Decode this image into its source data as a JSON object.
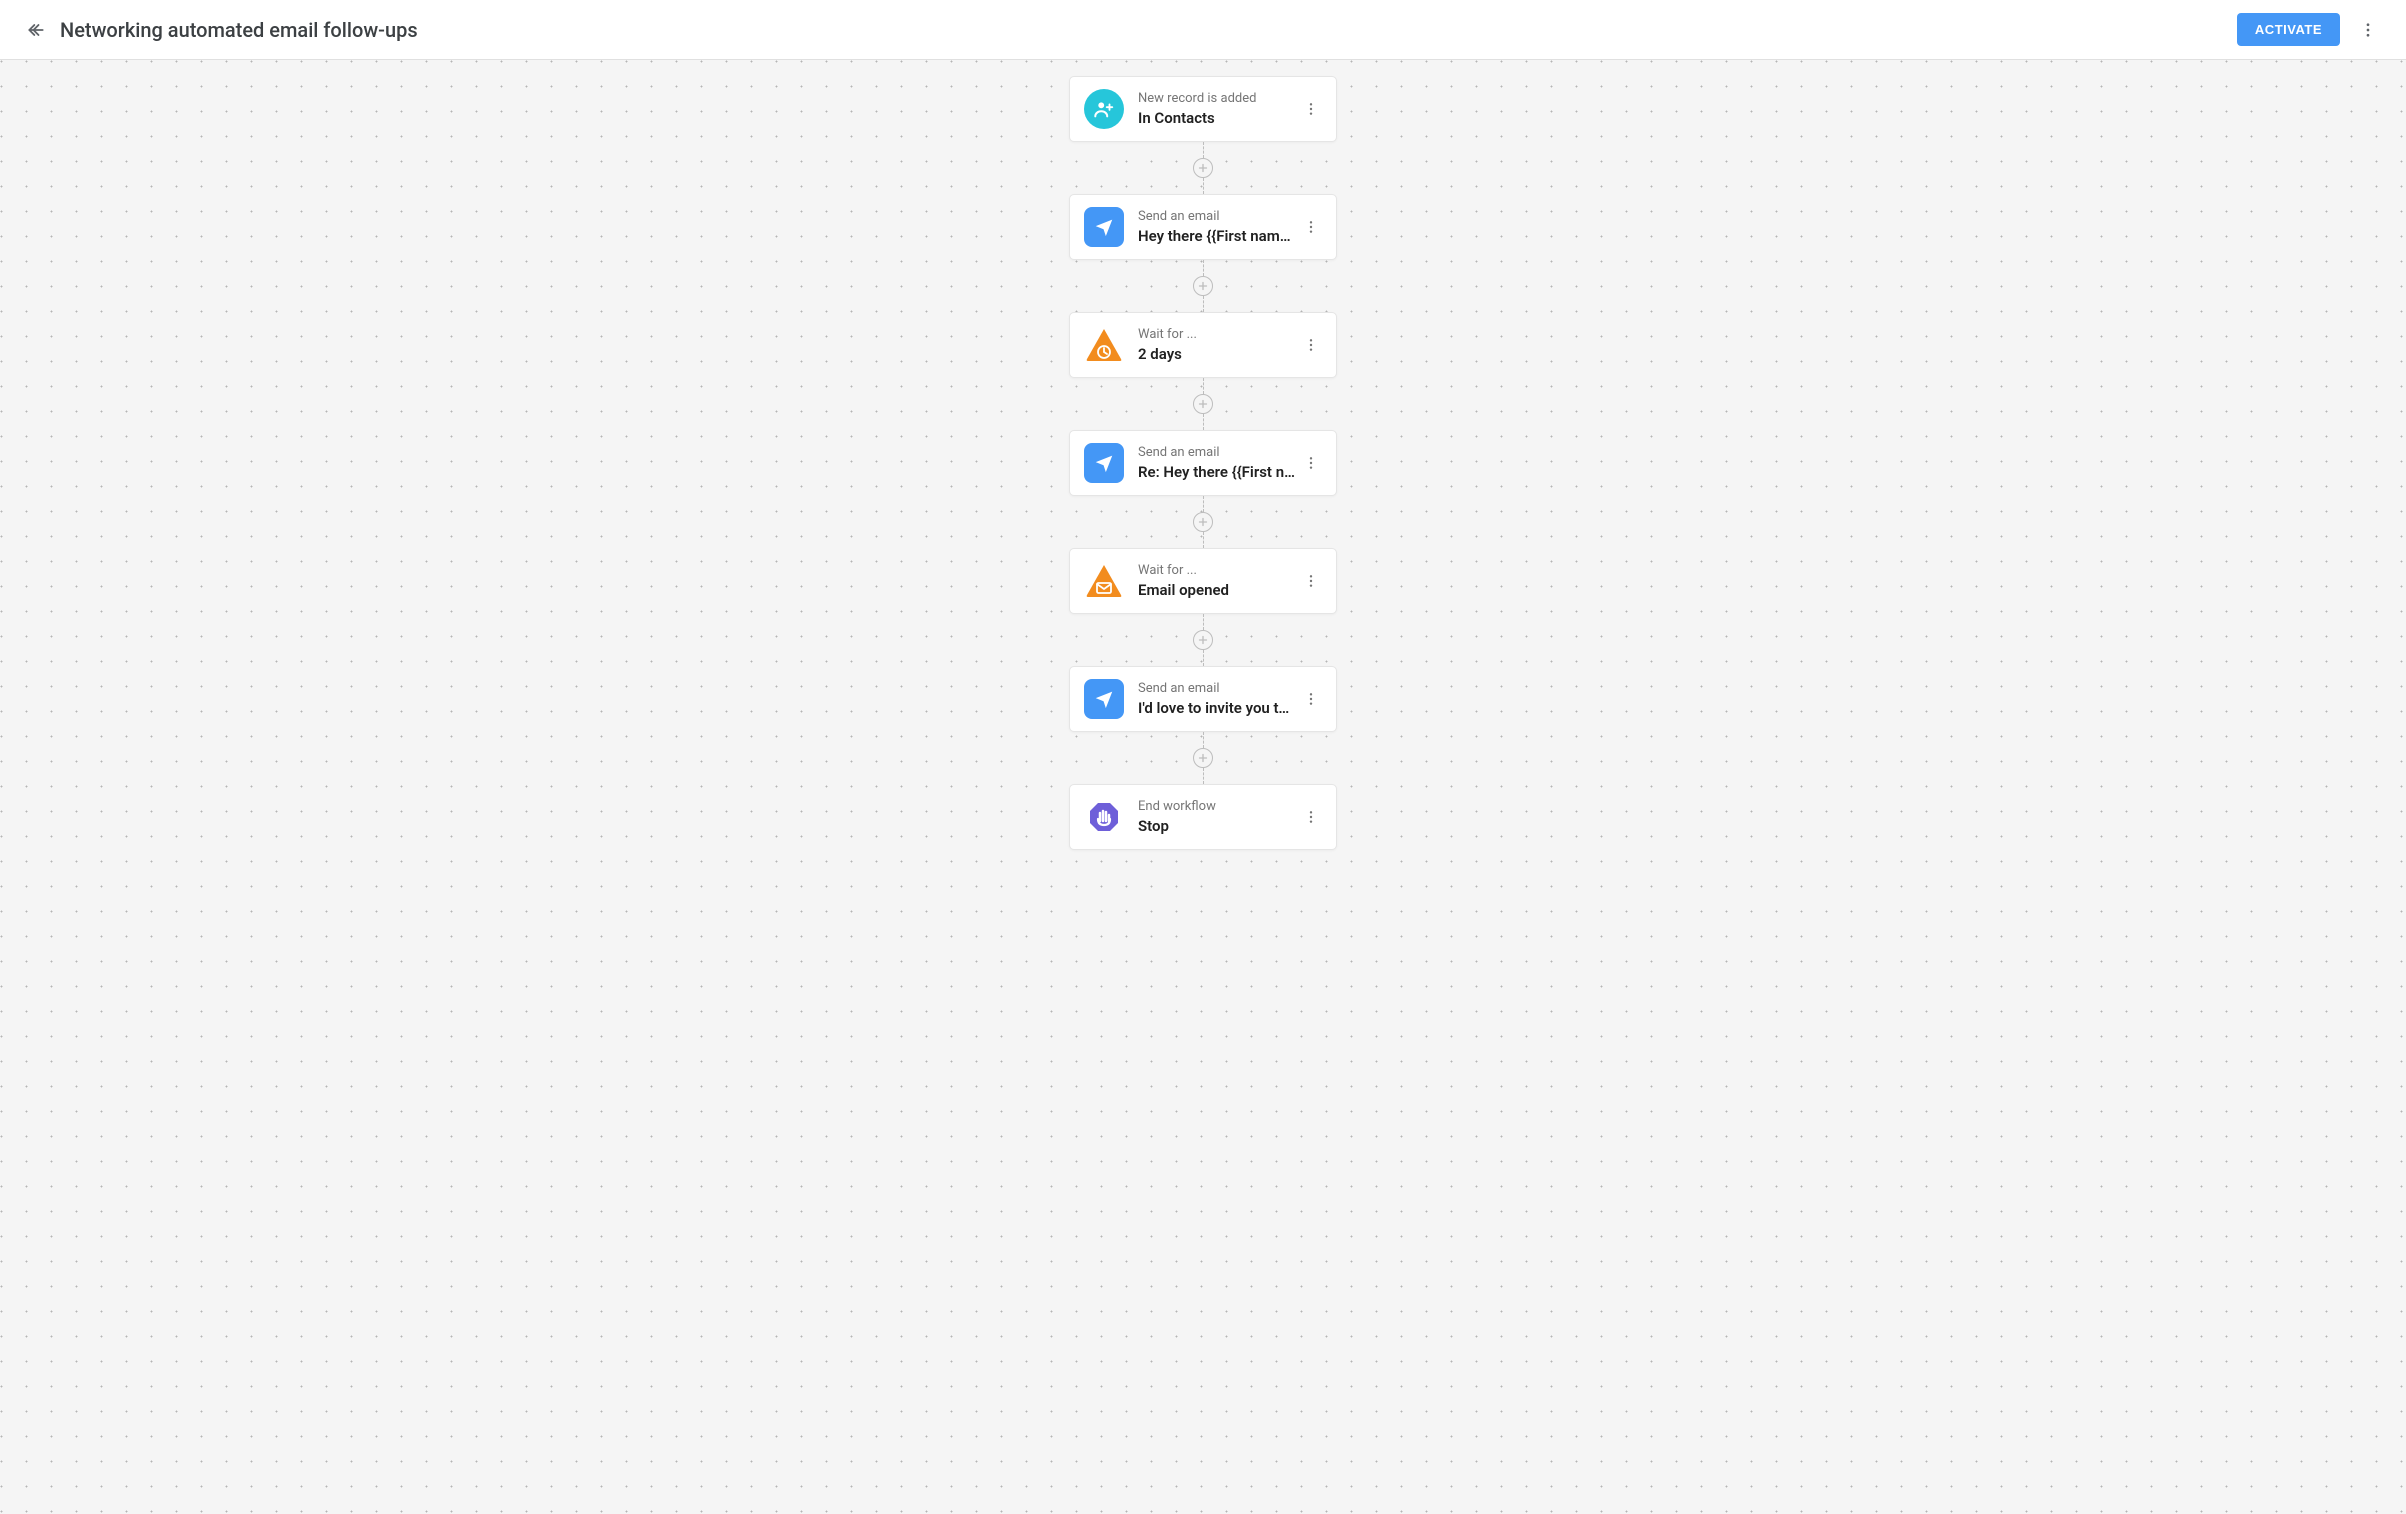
{
  "header": {
    "title": "Networking automated email follow-ups",
    "activate_label": "ACTIVATE"
  },
  "nodes": [
    {
      "icon": "person-add",
      "type_label": "New record is added",
      "title": "In Contacts"
    },
    {
      "icon": "send",
      "type_label": "Send an email",
      "title": "Hey there {{First name…"
    },
    {
      "icon": "wait-clock",
      "type_label": "Wait for ...",
      "title": "2 days"
    },
    {
      "icon": "send",
      "type_label": "Send an email",
      "title": "Re: Hey there {{First n…"
    },
    {
      "icon": "wait-mail",
      "type_label": "Wait for ...",
      "title": "Email opened"
    },
    {
      "icon": "send",
      "type_label": "Send an email",
      "title": "I'd love to invite you to…"
    },
    {
      "icon": "stop",
      "type_label": "End workflow",
      "title": "Stop"
    }
  ]
}
